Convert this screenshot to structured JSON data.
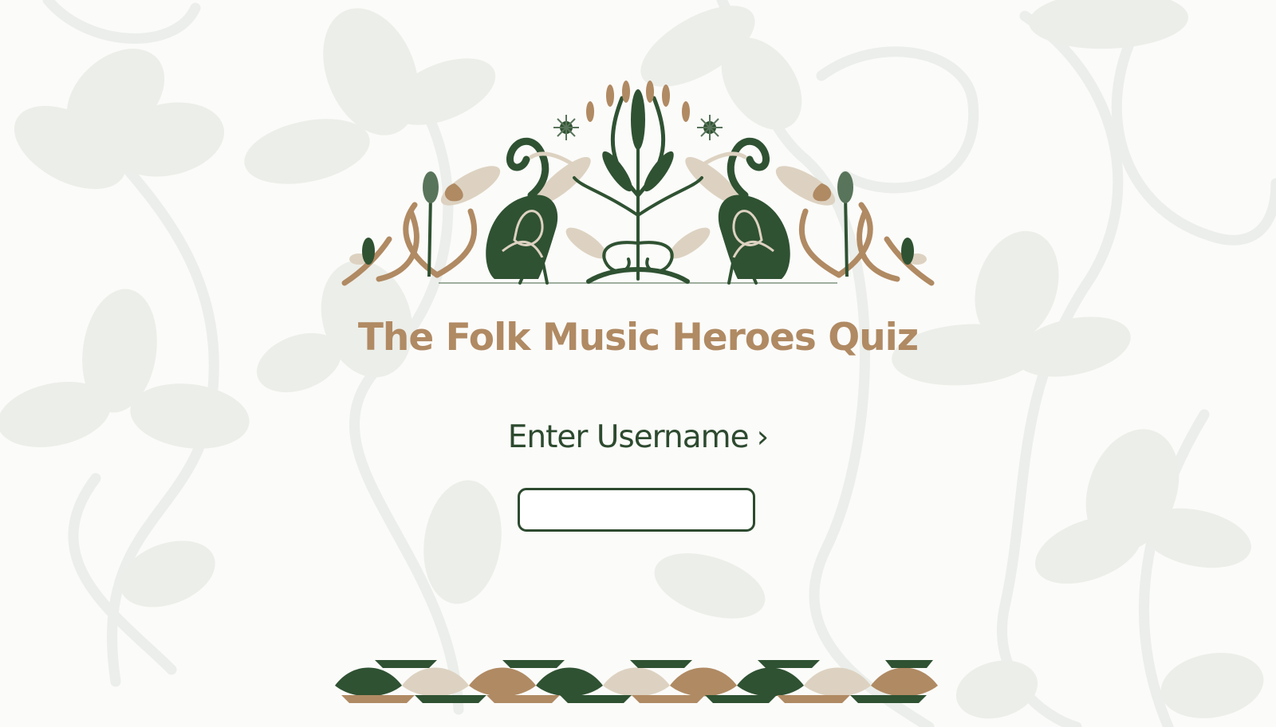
{
  "title": "The Folk Music Heroes Quiz",
  "prompt": {
    "label": "Enter Username",
    "chevron": "›"
  },
  "username_input": {
    "value": "",
    "placeholder": ""
  },
  "icons": {
    "background": "clover-vine-pattern",
    "header": "heron-folk-ornament",
    "footer": "leaf-border-ornament"
  },
  "colors": {
    "background": "#fbfbf9",
    "pattern": "#e9ece7",
    "title": "#b08a63",
    "text": "#2d4a2f",
    "ornament_green": "#2f5232",
    "ornament_tan": "#b08a63",
    "ornament_cream": "#ddd2c1"
  }
}
